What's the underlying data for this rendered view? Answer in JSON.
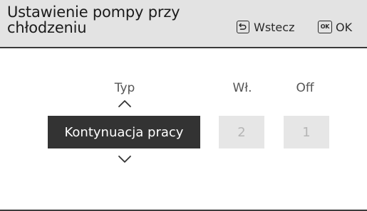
{
  "header": {
    "title_line1": "Ustawienie pompy przy",
    "title_line2": "chłodzeniu",
    "back": {
      "icon": "back-arrow-icon",
      "label": "Wstecz"
    },
    "ok": {
      "icon_text": "OK",
      "label": "OK"
    }
  },
  "columns": {
    "typ": {
      "label": "Typ",
      "value": "Kontynuacja pracy"
    },
    "wl": {
      "label": "Wł.",
      "value": "2"
    },
    "off": {
      "label": "Off",
      "value": "1"
    }
  },
  "colors": {
    "header_bg": "#e3e3e3",
    "selected_bg": "#333333",
    "disabled_bg": "#e6e6e6",
    "disabled_text": "#b5b5b5"
  }
}
